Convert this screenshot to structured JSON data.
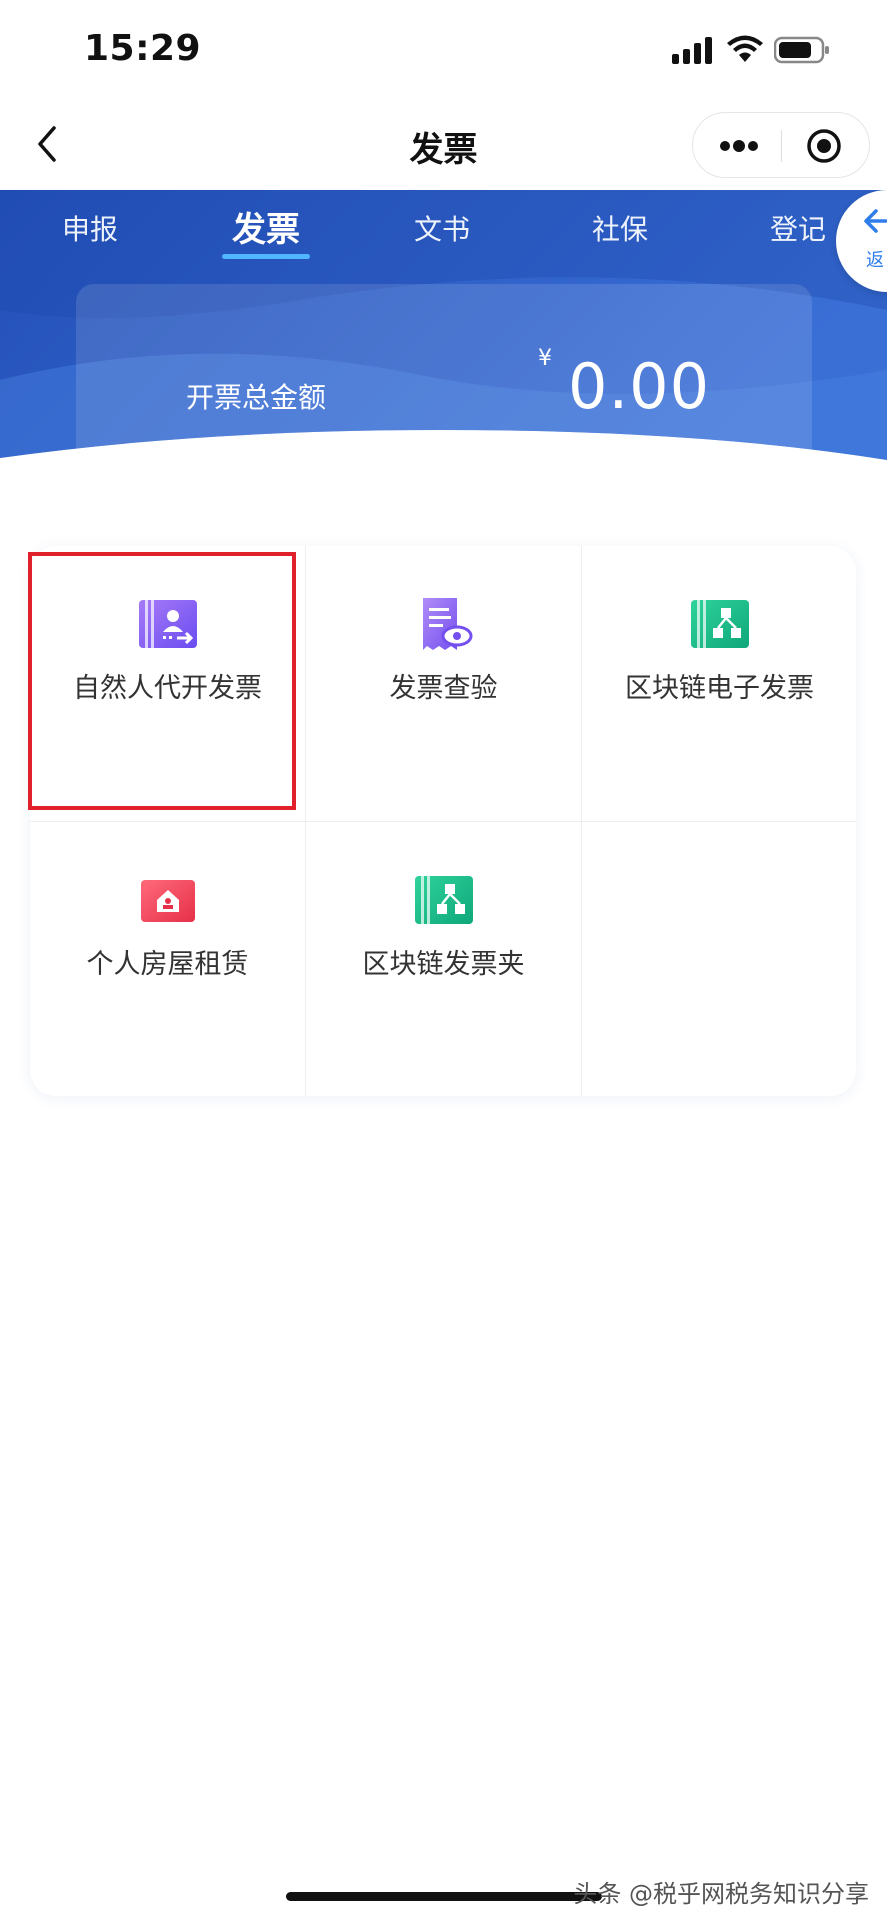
{
  "status_bar": {
    "time": "15:29"
  },
  "nav": {
    "title": "发票"
  },
  "tabs": [
    {
      "label": "申报"
    },
    {
      "label": "发票"
    },
    {
      "label": "文书"
    },
    {
      "label": "社保"
    },
    {
      "label": "登记"
    }
  ],
  "return_button": {
    "label": "返"
  },
  "summary": {
    "label": "开票总金额",
    "currency": "¥",
    "amount": "0.00"
  },
  "grid": {
    "items": [
      {
        "label": "自然人代开发票",
        "icon": "natural-person-invoice-icon",
        "color": "#7b5cf5"
      },
      {
        "label": "发票查验",
        "icon": "invoice-verify-icon",
        "color": "#8b6cf7"
      },
      {
        "label": "区块链电子发票",
        "icon": "blockchain-invoice-icon",
        "color": "#16c08a"
      },
      {
        "label": "个人房屋租赁",
        "icon": "house-rental-icon",
        "color": "#f2465a"
      },
      {
        "label": "区块链发票夹",
        "icon": "blockchain-folder-icon",
        "color": "#16c08a"
      }
    ]
  },
  "watermark": "头条 @税乎网税务知识分享",
  "colors": {
    "header_blue": "#2d5fc4",
    "highlight_red": "#e0202a",
    "tab_indicator": "#4fb6ff"
  }
}
